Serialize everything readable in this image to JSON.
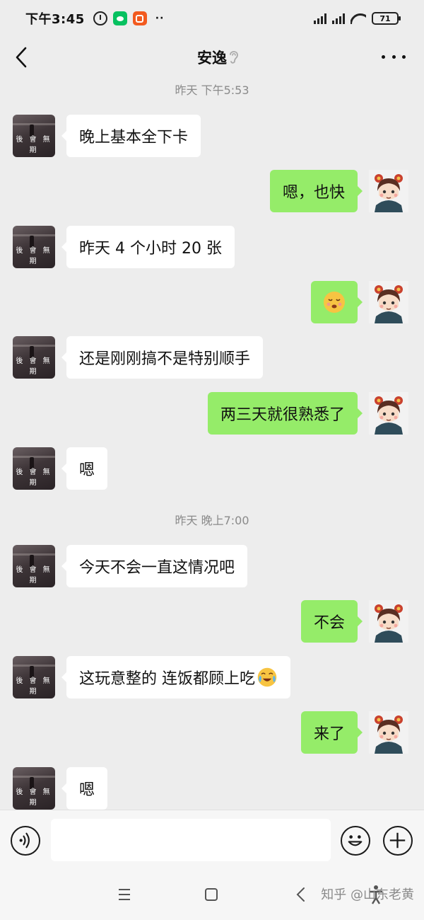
{
  "status_bar": {
    "time": "下午3:45",
    "more": "··",
    "battery": "71"
  },
  "header": {
    "title": "安逸"
  },
  "timestamps": [
    {
      "text": "昨天 下午5:53"
    },
    {
      "text": "昨天 晚上7:00"
    }
  ],
  "messages": [
    {
      "side": "left",
      "text": "晚上基本全下卡"
    },
    {
      "side": "right",
      "text": "嗯，也快"
    },
    {
      "side": "left",
      "text": "昨天 4 个小时 20 张"
    },
    {
      "side": "right",
      "text": "",
      "emoji": "shushing-face"
    },
    {
      "side": "left",
      "text": "还是刚刚搞不是特别顺手"
    },
    {
      "side": "right",
      "text": "两三天就很熟悉了"
    },
    {
      "side": "left",
      "text": "嗯"
    },
    {
      "side": "left",
      "text": "今天不会一直这情况吧"
    },
    {
      "side": "right",
      "text": "不会"
    },
    {
      "side": "left",
      "text": "这玩意整的 连饭都顾上吃",
      "emoji": "crying-laughing-face"
    },
    {
      "side": "right",
      "text": "来了"
    },
    {
      "side": "left",
      "text": "嗯"
    }
  ],
  "contact_avatar": {
    "caption": "後 會 無 期"
  },
  "input": {
    "value": "",
    "placeholder": ""
  },
  "watermark": "知乎 @山东老黄",
  "colors": {
    "background": "#ededed",
    "bubble_self": "#95ec69",
    "bubble_other": "#ffffff",
    "timestamp": "#8a8a8a"
  }
}
